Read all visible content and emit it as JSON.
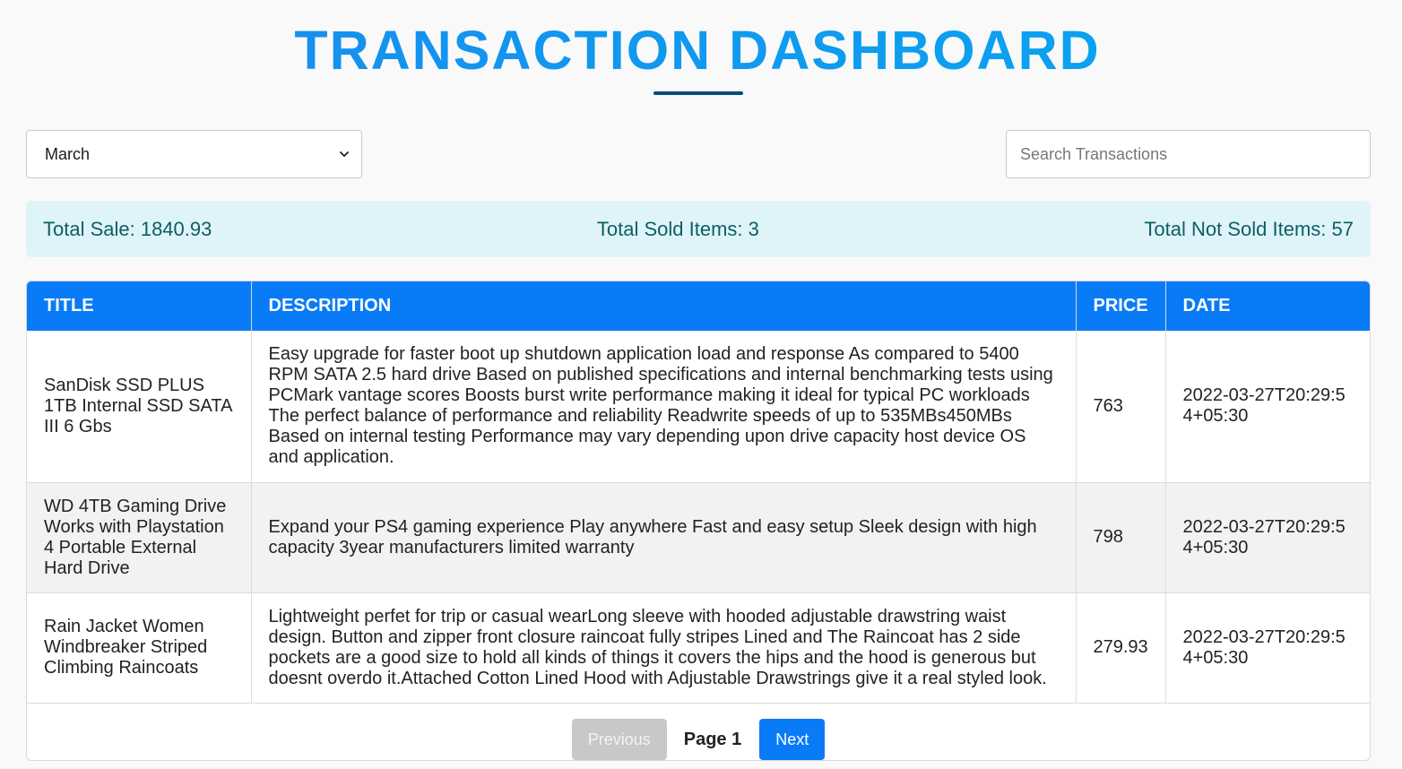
{
  "header": {
    "title": "TRANSACTION DASHBOARD"
  },
  "filters": {
    "month": {
      "selected": "March"
    },
    "search": {
      "placeholder": "Search Transactions",
      "value": ""
    }
  },
  "stats": {
    "total_sale": "Total Sale: 1840.93",
    "total_sold": "Total Sold Items: 3",
    "total_not_sold": "Total Not Sold Items: 57"
  },
  "table": {
    "columns": [
      "TITLE",
      "DESCRIPTION",
      "PRICE",
      "DATE"
    ],
    "rows": [
      {
        "title": "SanDisk SSD PLUS 1TB Internal SSD SATA III 6 Gbs",
        "description": "Easy upgrade for faster boot up shutdown application load and response As compared to 5400 RPM SATA 2.5 hard drive Based on published specifications and internal benchmarking tests using PCMark vantage scores Boosts burst write performance making it ideal for typical PC workloads The perfect balance of performance and reliability Readwrite speeds of up to 535MBs450MBs Based on internal testing Performance may vary depending upon drive capacity host device OS and application.",
        "price": "763",
        "date": "2022-03-27T20:29:54+05:30"
      },
      {
        "title": "WD 4TB Gaming Drive Works with Playstation 4 Portable External Hard Drive",
        "description": "Expand your PS4 gaming experience Play anywhere Fast and easy setup Sleek design with high capacity 3year manufacturers limited warranty",
        "price": "798",
        "date": "2022-03-27T20:29:54+05:30"
      },
      {
        "title": "Rain Jacket Women Windbreaker Striped Climbing Raincoats",
        "description": "Lightweight perfet for trip or casual wearLong sleeve with hooded adjustable drawstring waist design. Button and zipper front closure raincoat fully stripes Lined and The Raincoat has 2 side pockets are a good size to hold all kinds of things it covers the hips and the hood is generous but doesnt overdo it.Attached Cotton Lined Hood with Adjustable Drawstrings give it a real styled look.",
        "price": "279.93",
        "date": "2022-03-27T20:29:54+05:30"
      }
    ]
  },
  "pagination": {
    "previous_label": "Previous",
    "page_label": "Page 1",
    "next_label": "Next"
  },
  "colors": {
    "accent": "#0a7bf7",
    "title_gradient_start": "#1a8aee",
    "title_gradient_end": "#06a8f0",
    "stats_bg": "#dff4f8",
    "stats_text": "#0d5e66",
    "disabled_button": "#c8c8c8"
  },
  "icons": {
    "month_dropdown": "chevron-down-icon"
  }
}
